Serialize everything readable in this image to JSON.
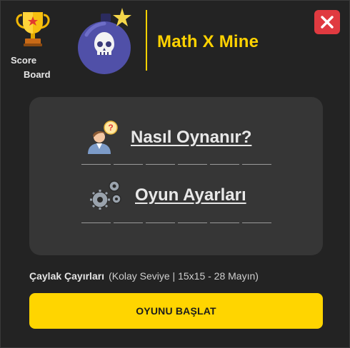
{
  "header": {
    "scoreboard_line1": "Score",
    "scoreboard_line2": "Board",
    "title": "Math X Mine"
  },
  "menu": {
    "how_to_play": "Nasıl Oynanır?",
    "game_settings": "Oyun Ayarları"
  },
  "level": {
    "name": "Çaylak Çayırları",
    "info": "(Kolay Seviye | 15x15 - 28 Mayın)"
  },
  "start_button": "OYUNU BAŞLAT",
  "colors": {
    "accent": "#ffd500",
    "close": "#e03a40",
    "panel": "#363636",
    "background": "#232323"
  },
  "icons": {
    "scoreboard": "trophy-icon",
    "logo": "skull-bomb-icon",
    "close": "close-icon",
    "how_to_play": "question-person-icon",
    "settings": "gears-icon"
  }
}
